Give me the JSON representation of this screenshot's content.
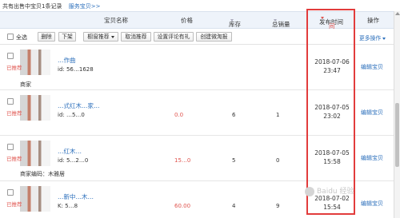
{
  "summary": {
    "count_text": "共有出售中宝贝1条记录",
    "service_link": "服务宝贝>>"
  },
  "header": {
    "product_name": "宝贝名称",
    "price": "价格",
    "stock": "库存",
    "total_sales": "总销量",
    "publish_time": "发布时间",
    "publish_time_2": "间",
    "action": "操作"
  },
  "toolbar": {
    "select_all": "全选",
    "delete": "删除",
    "delist": "下架",
    "recommend": "橱窗推荐",
    "cancel_recommend": "取消推荐",
    "set_review_gift": "设置评论有礼",
    "create_taobao_buy": "创建微淘报",
    "more_actions": "更多操作"
  },
  "rows": [
    {
      "tag": "已推荐",
      "title": "…作曲",
      "sub": "id: 56…1628",
      "code": "商家",
      "price": "",
      "stock": "",
      "sales": "",
      "date": "2018-07-06",
      "time": "23:47",
      "edit": "编辑宝贝"
    },
    {
      "tag": "已推荐",
      "title": "…式红木…家…",
      "sub": "id: …5…0",
      "code": "",
      "price": "0.0",
      "stock": "6",
      "sales": "1",
      "date": "2018-07-05",
      "time": "23:02",
      "edit": "编辑宝贝"
    },
    {
      "tag": "已推荐",
      "title": "…红木…",
      "sub": "id: 5…2…0",
      "code": "商家编码：木雅居",
      "price": "15…0",
      "stock": "5",
      "sales": "0",
      "date": "2018-07-05",
      "time": "15:58",
      "edit": "编辑宝贝"
    },
    {
      "tag": "已推荐",
      "title": "…新中…木…",
      "sub": "K: 5…8",
      "code": "",
      "price": "60.00",
      "stock": "4",
      "sales": "9",
      "date": "2018-07-02",
      "time": "15:54",
      "edit": "编辑宝贝"
    }
  ],
  "watermark": {
    "text": "Baidu 经验"
  },
  "colors": {
    "accent_blue": "#2a6ebb",
    "highlight_red": "#e23c3c",
    "price_red": "#e0544e"
  }
}
